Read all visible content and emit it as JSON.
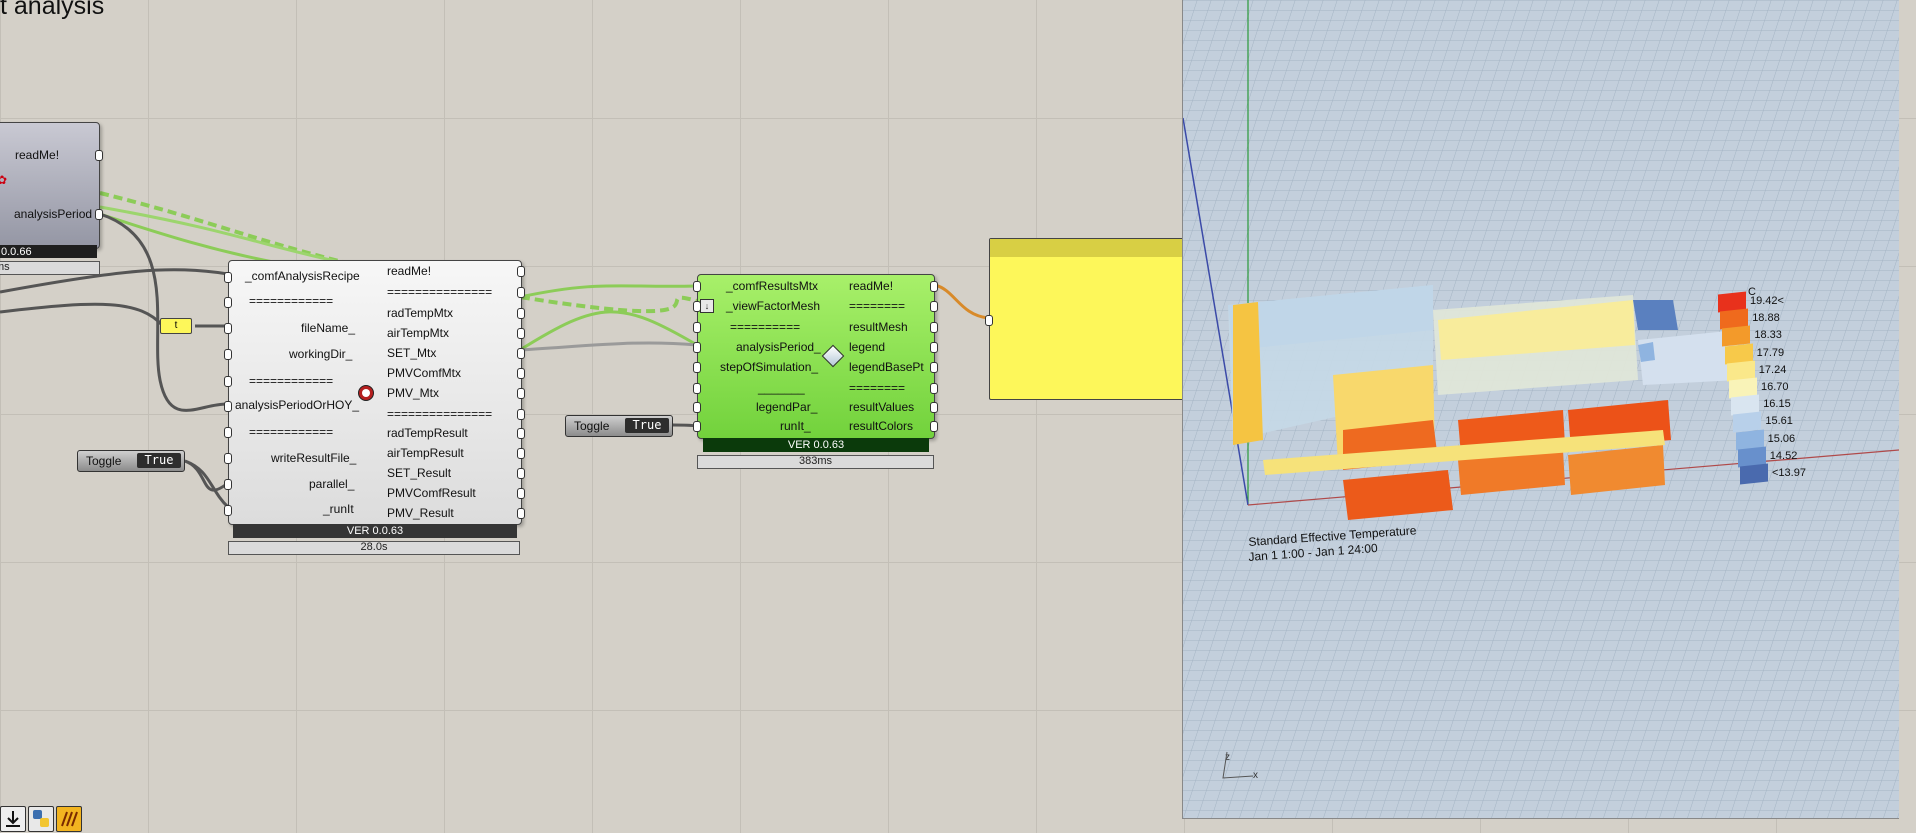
{
  "page_title": "t analysis",
  "colors": {
    "canvas": "#d4d0c8",
    "component_grey": "#e8e8e8",
    "component_green": "#86e04c",
    "panel_yellow": "#fdf75a",
    "wire_green": "#8ccc58",
    "wire_dark": "#555555",
    "viewport_bg": "#c3cfdc"
  },
  "left_component": {
    "outputs": [
      "readMe!",
      "analysisPeriod"
    ],
    "version": "0.0.66",
    "time": "ms"
  },
  "comf_recipe_component": {
    "inputs": [
      "_comfAnalysisRecipe",
      "============",
      "fileName_",
      "workingDir_",
      "============",
      "analysisPeriodOrHOY_",
      "============",
      "writeResultFile_",
      "parallel_",
      "_runIt"
    ],
    "outputs": [
      "readMe!",
      "===============",
      "radTempMtx",
      "airTempMtx",
      "SET_Mtx",
      "PMVComfMtx",
      "PMV_Mtx",
      "===============",
      "radTempResult",
      "airTempResult",
      "SET_Result",
      "PMVComfResult",
      "PMV_Result"
    ],
    "version": "VER 0.0.63",
    "time": "28.0s",
    "icon": "honeybee-runner-icon"
  },
  "comf_results_component": {
    "inputs": [
      "_comfResultsMtx",
      "_viewFactorMesh",
      "==========",
      "analysisPeriod_",
      "stepOfSimulation_",
      "_______",
      "legendPar_",
      "runIt_"
    ],
    "outputs": [
      "readMe!",
      "========",
      "resultMesh",
      "legend",
      "legendBasePt",
      "========",
      "resultValues",
      "resultColors"
    ],
    "version": "VER 0.0.63",
    "time": "383ms",
    "icon": "ladybug-mesh-icon"
  },
  "relay": {
    "label": "t"
  },
  "toggles": [
    {
      "label": "Toggle",
      "value": "True"
    },
    {
      "label": "Toggle",
      "value": "True"
    }
  ],
  "viewport": {
    "chart_title_line1": "Standard Effective Temperature",
    "chart_title_line2": "Jan 1 1:00 - Jan 1 24:00",
    "legend_unit": "C",
    "legend_values": [
      "19.42<",
      "18.88",
      "18.33",
      "17.79",
      "17.24",
      "16.70",
      "16.15",
      "15.61",
      "15.06",
      "14.52",
      "<13.97"
    ],
    "legend_colors": [
      "#e8311c",
      "#ef6a1d",
      "#f39a2a",
      "#f7c94a",
      "#fae88a",
      "#f9f3b8",
      "#d9e5f0",
      "#b8d0ea",
      "#8fb4e0",
      "#6890cc",
      "#4a6aae"
    ],
    "axis_z": "z",
    "axis_x": "x"
  },
  "taskbar": {
    "icons": [
      "download-icon",
      "python-icon",
      "ladybug-icon"
    ]
  }
}
